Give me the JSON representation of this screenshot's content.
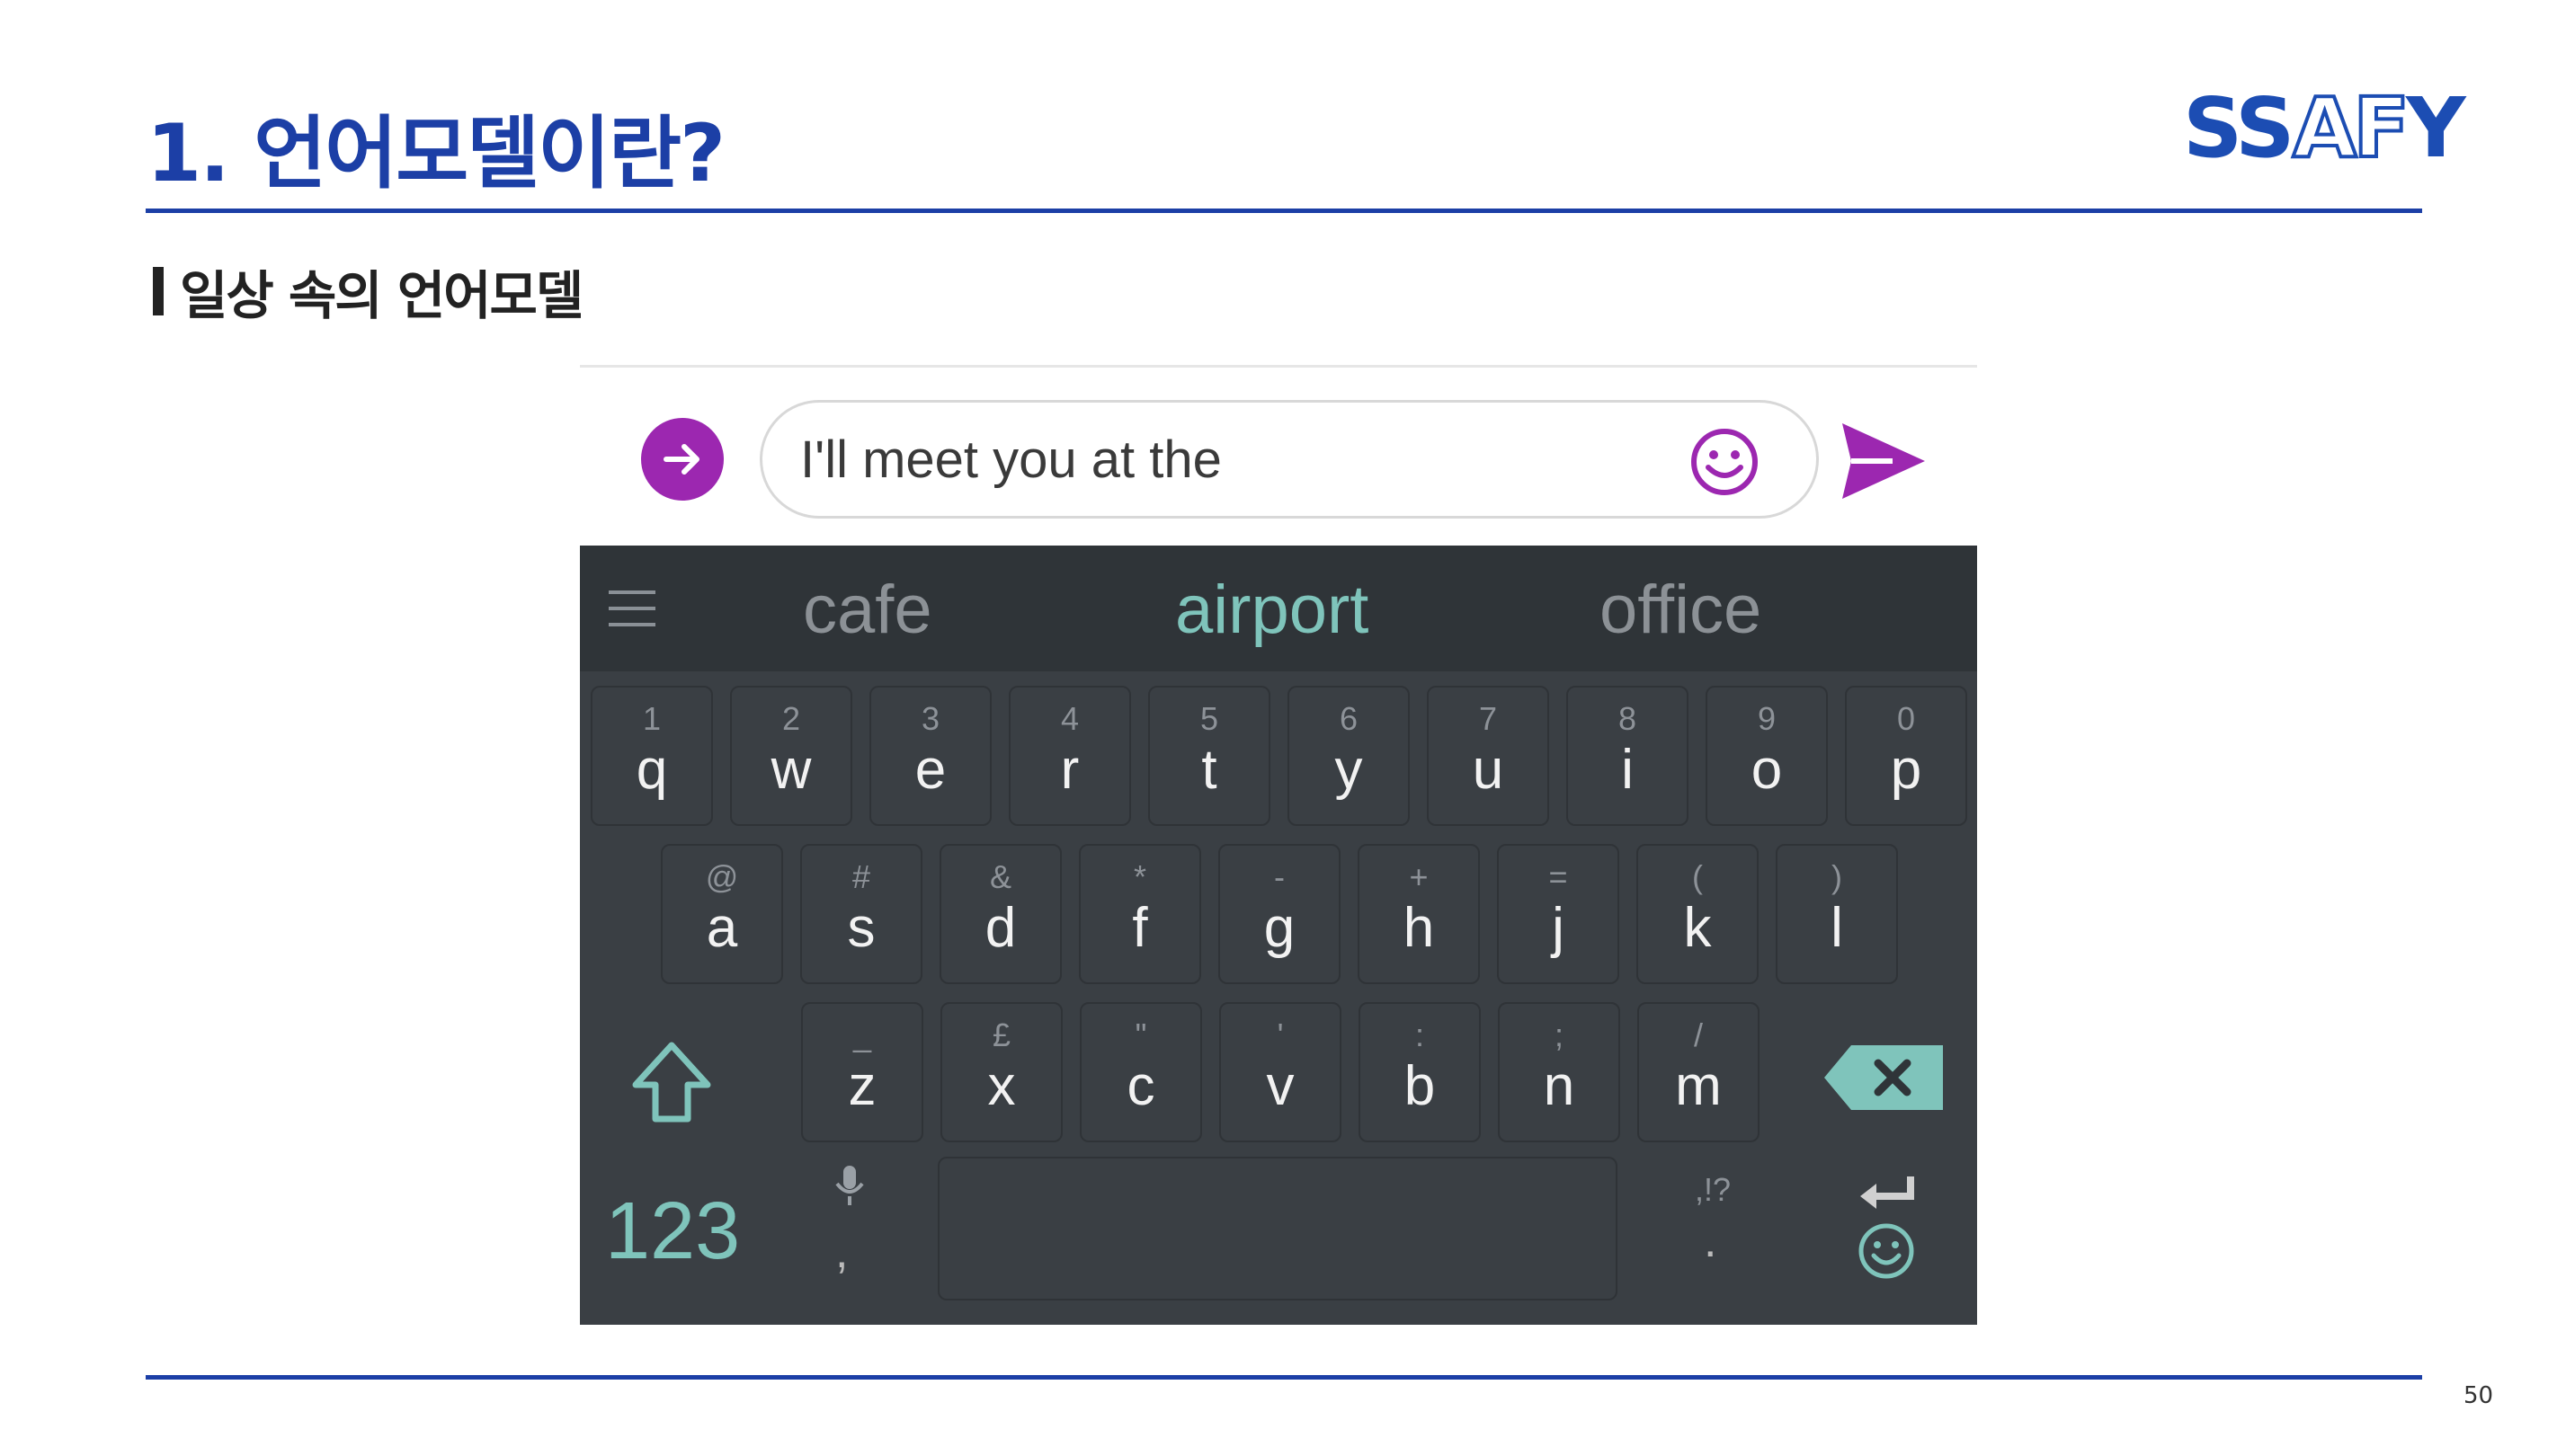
{
  "slide": {
    "title": "1. 언어모델이란?",
    "subtitle": "일상 속의 언어모델",
    "logo_text": "SSAFY",
    "page_number": "50"
  },
  "compose": {
    "input_value": "I'll meet you at the",
    "accent_color": "#9c27b0"
  },
  "keyboard": {
    "suggestions": [
      "cafe",
      "airport",
      "office"
    ],
    "rows": [
      [
        {
          "alt": "1",
          "key": "q"
        },
        {
          "alt": "2",
          "key": "w"
        },
        {
          "alt": "3",
          "key": "e"
        },
        {
          "alt": "4",
          "key": "r"
        },
        {
          "alt": "5",
          "key": "t"
        },
        {
          "alt": "6",
          "key": "y"
        },
        {
          "alt": "7",
          "key": "u"
        },
        {
          "alt": "8",
          "key": "i"
        },
        {
          "alt": "9",
          "key": "o"
        },
        {
          "alt": "0",
          "key": "p"
        }
      ],
      [
        {
          "alt": "@",
          "key": "a"
        },
        {
          "alt": "#",
          "key": "s"
        },
        {
          "alt": "&",
          "key": "d"
        },
        {
          "alt": "*",
          "key": "f"
        },
        {
          "alt": "-",
          "key": "g"
        },
        {
          "alt": "+",
          "key": "h"
        },
        {
          "alt": "=",
          "key": "j"
        },
        {
          "alt": "(",
          "key": "k"
        },
        {
          "alt": ")",
          "key": "l"
        }
      ],
      [
        {
          "alt": "_",
          "key": "z"
        },
        {
          "alt": "£",
          "key": "x"
        },
        {
          "alt": "\"",
          "key": "c"
        },
        {
          "alt": "'",
          "key": "v"
        },
        {
          "alt": ":",
          "key": "b"
        },
        {
          "alt": ";",
          "key": "n"
        },
        {
          "alt": "/",
          "key": "m"
        }
      ]
    ],
    "numbers_label": "123",
    "comma_label": ",",
    "punct_alt": ",!?",
    "punct_label": ".",
    "accent_color": "#7fc4bb"
  }
}
